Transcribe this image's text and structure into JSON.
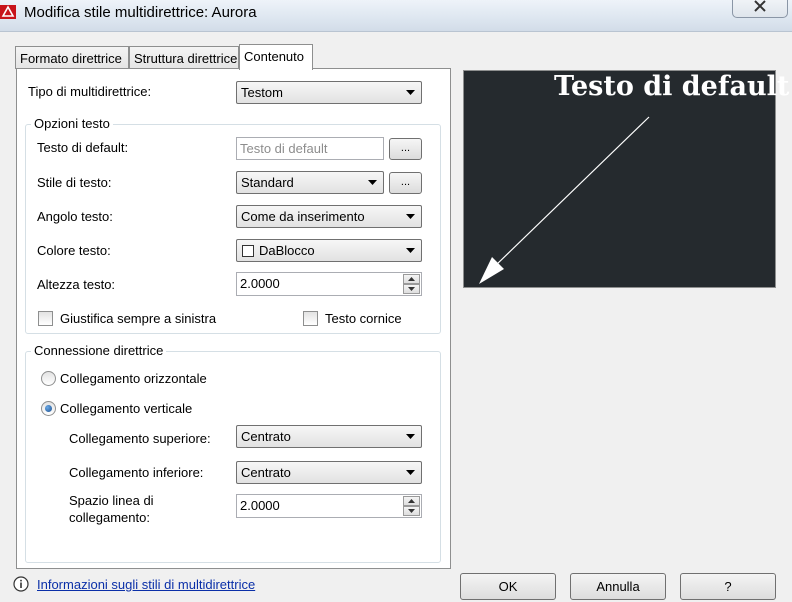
{
  "window": {
    "title": "Modifica stile multidirettrice: Aurora"
  },
  "tabs": [
    {
      "label": "Formato direttrice"
    },
    {
      "label": "Struttura direttrice"
    },
    {
      "label": "Contenuto"
    }
  ],
  "content": {
    "multileader_type_label": "Tipo di multidirettrice:",
    "multileader_type_value": "Testom",
    "text_options": {
      "title": "Opzioni testo",
      "default_text_label": "Testo di default:",
      "default_text_value": "Testo di default",
      "default_text_button": "...",
      "text_style_label": "Stile di testo:",
      "text_style_value": "Standard",
      "text_style_button": "...",
      "text_angle_label": "Angolo testo:",
      "text_angle_value": "Come da inserimento",
      "text_color_label": "Colore testo:",
      "text_color_value": "DaBlocco",
      "text_height_label": "Altezza testo:",
      "text_height_value": "2.0000",
      "left_justify_label": "Giustifica sempre a sinistra",
      "frame_text_label": "Testo cornice"
    },
    "leader_connection": {
      "title": "Connessione direttrice",
      "horizontal_label": "Collegamento orizzontale",
      "vertical_label": "Collegamento verticale",
      "selected": "vertical",
      "top_attachment_label": "Collegamento superiore:",
      "top_attachment_value": "Centrato",
      "bottom_attachment_label": "Collegamento inferiore:",
      "bottom_attachment_value": "Centrato",
      "gap_label_line1": "Spazio linea di",
      "gap_label_line2": "collegamento:",
      "gap_value": "2.0000"
    }
  },
  "preview": {
    "text": "Testo di default",
    "background": "#252a2e"
  },
  "footer": {
    "info_link": "Informazioni sugli stili di multidirettrice",
    "ok_label": "OK",
    "cancel_label": "Annulla",
    "help_label": "?"
  }
}
